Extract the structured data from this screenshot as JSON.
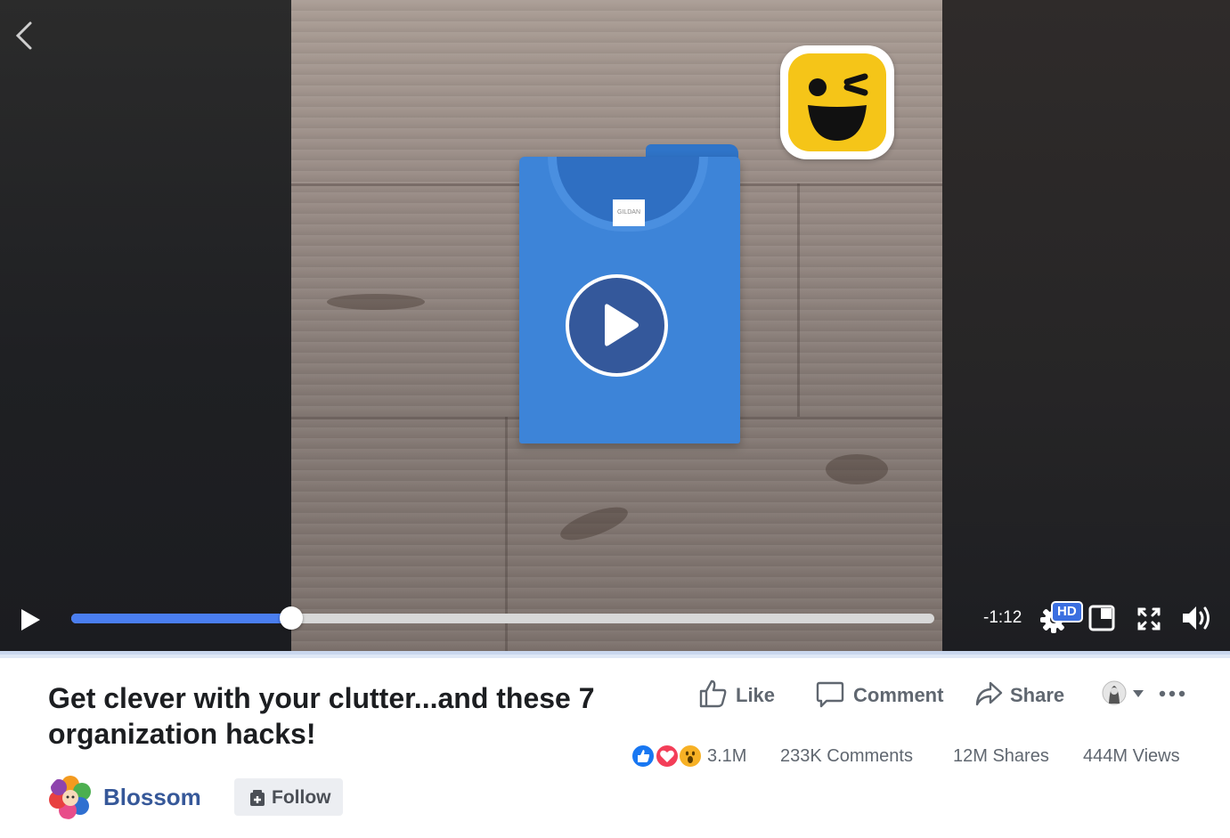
{
  "video": {
    "progress_fraction": 0.255,
    "time_remaining": "-1:12",
    "hd_label": "HD",
    "shirt_tag": "GILDAN"
  },
  "post": {
    "title": "Get clever with your clutter...and these 7 organization hacks!",
    "page_name": "Blossom",
    "follow_label": "Follow"
  },
  "actions": {
    "like": "Like",
    "comment": "Comment",
    "share": "Share"
  },
  "stats": {
    "reactions": "3.1M",
    "comments": "233K Comments",
    "shares": "12M Shares",
    "views": "444M Views"
  },
  "colors": {
    "accent": "#4a7ef0",
    "page_link": "#365899",
    "like_blue": "#1877f2",
    "love_red": "#f33e58",
    "wow_yellow": "#f7b125"
  },
  "icons": [
    "back-arrow-icon",
    "play-icon",
    "settings-gear-icon",
    "pip-icon",
    "fullscreen-icon",
    "volume-icon",
    "like-icon",
    "comment-icon",
    "share-icon",
    "more-icon",
    "chevron-down-icon"
  ]
}
